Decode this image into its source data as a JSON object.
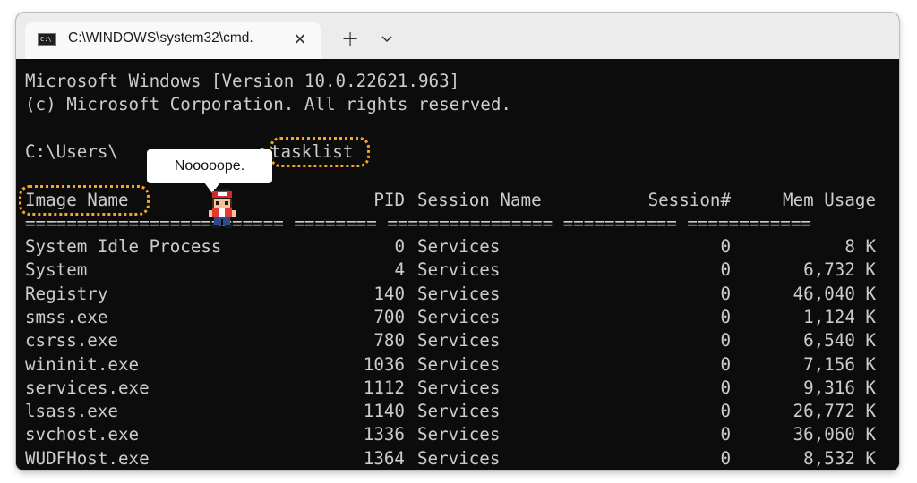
{
  "window": {
    "tab_title": "C:\\WINDOWS\\system32\\cmd.",
    "tab_icon_text": "C:\\",
    "close_icon": "close-icon",
    "new_tab_icon": "plus-icon",
    "dropdown_icon": "chevron-down-icon"
  },
  "terminal": {
    "line1": "Microsoft Windows [Version 10.0.22621.963]",
    "line2": "(c) Microsoft Corporation. All rights reserved.",
    "prompt": "C:\\Users\\",
    "prompt_gt": ">",
    "command": "tasklist",
    "headers": {
      "image_name": "Image Name",
      "pid": "PID",
      "session_name": "Session Name",
      "session_num": "Session#",
      "mem_usage": "Mem Usage"
    },
    "separator": "========================= ======== ================ =========== ============",
    "processes": [
      {
        "name": "System Idle Process",
        "pid": "0",
        "session": "Services",
        "session_num": "0",
        "mem": "8 K"
      },
      {
        "name": "System",
        "pid": "4",
        "session": "Services",
        "session_num": "0",
        "mem": "6,732 K"
      },
      {
        "name": "Registry",
        "pid": "140",
        "session": "Services",
        "session_num": "0",
        "mem": "46,040 K"
      },
      {
        "name": "smss.exe",
        "pid": "700",
        "session": "Services",
        "session_num": "0",
        "mem": "1,124 K"
      },
      {
        "name": "csrss.exe",
        "pid": "780",
        "session": "Services",
        "session_num": "0",
        "mem": "6,540 K"
      },
      {
        "name": "wininit.exe",
        "pid": "1036",
        "session": "Services",
        "session_num": "0",
        "mem": "7,156 K"
      },
      {
        "name": "services.exe",
        "pid": "1112",
        "session": "Services",
        "session_num": "0",
        "mem": "9,316 K"
      },
      {
        "name": "lsass.exe",
        "pid": "1140",
        "session": "Services",
        "session_num": "0",
        "mem": "26,772 K"
      },
      {
        "name": "svchost.exe",
        "pid": "1336",
        "session": "Services",
        "session_num": "0",
        "mem": "36,060 K"
      },
      {
        "name": "WUDFHost.exe",
        "pid": "1364",
        "session": "Services",
        "session_num": "0",
        "mem": "8,532 K"
      }
    ]
  },
  "annotation": {
    "callout_text": "Nooooope.",
    "highlight_color": "#f5a623",
    "sprite": "pixel-trainer-sprite"
  },
  "colors": {
    "terminal_bg": "#0c0c0c",
    "terminal_fg": "#cccccc",
    "titlebar_bg": "#ececec"
  }
}
